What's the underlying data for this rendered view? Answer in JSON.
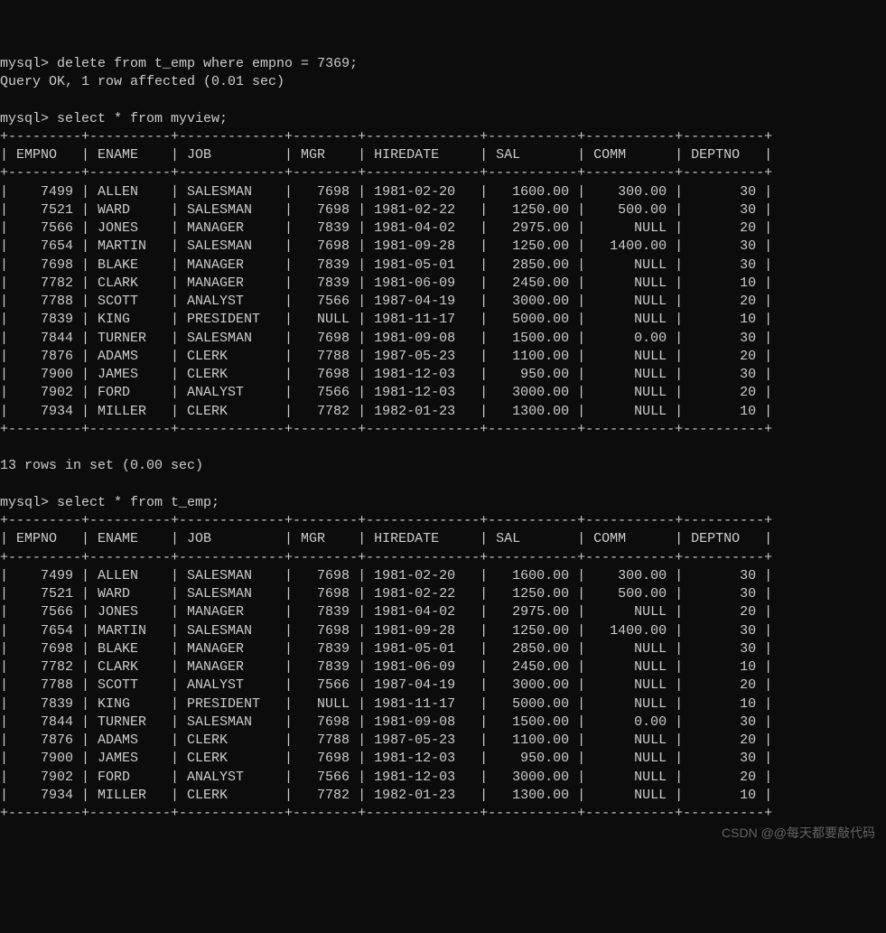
{
  "prompt": "mysql> ",
  "commands": {
    "delete": "delete from t_emp where empno = 7369;",
    "result1": "Query OK, 1 row affected (0.01 sec)",
    "select_view": "select * from myview;",
    "rows_in_set": "13 rows in set (0.00 sec)",
    "select_temp": "select * from t_emp;"
  },
  "columns": [
    "EMPNO",
    "ENAME",
    "JOB",
    "MGR",
    "HIREDATE",
    "SAL",
    "COMM",
    "DEPTNO"
  ],
  "widths": [
    7,
    8,
    11,
    6,
    12,
    9,
    9,
    8
  ],
  "col_align": [
    "right",
    "left",
    "left",
    "right",
    "left",
    "right",
    "right",
    "right"
  ],
  "rows": [
    {
      "EMPNO": "7499",
      "ENAME": "ALLEN",
      "JOB": "SALESMAN",
      "MGR": "7698",
      "HIREDATE": "1981-02-20",
      "SAL": "1600.00",
      "COMM": "300.00",
      "DEPTNO": "30"
    },
    {
      "EMPNO": "7521",
      "ENAME": "WARD",
      "JOB": "SALESMAN",
      "MGR": "7698",
      "HIREDATE": "1981-02-22",
      "SAL": "1250.00",
      "COMM": "500.00",
      "DEPTNO": "30"
    },
    {
      "EMPNO": "7566",
      "ENAME": "JONES",
      "JOB": "MANAGER",
      "MGR": "7839",
      "HIREDATE": "1981-04-02",
      "SAL": "2975.00",
      "COMM": "NULL",
      "DEPTNO": "20"
    },
    {
      "EMPNO": "7654",
      "ENAME": "MARTIN",
      "JOB": "SALESMAN",
      "MGR": "7698",
      "HIREDATE": "1981-09-28",
      "SAL": "1250.00",
      "COMM": "1400.00",
      "DEPTNO": "30"
    },
    {
      "EMPNO": "7698",
      "ENAME": "BLAKE",
      "JOB": "MANAGER",
      "MGR": "7839",
      "HIREDATE": "1981-05-01",
      "SAL": "2850.00",
      "COMM": "NULL",
      "DEPTNO": "30"
    },
    {
      "EMPNO": "7782",
      "ENAME": "CLARK",
      "JOB": "MANAGER",
      "MGR": "7839",
      "HIREDATE": "1981-06-09",
      "SAL": "2450.00",
      "COMM": "NULL",
      "DEPTNO": "10"
    },
    {
      "EMPNO": "7788",
      "ENAME": "SCOTT",
      "JOB": "ANALYST",
      "MGR": "7566",
      "HIREDATE": "1987-04-19",
      "SAL": "3000.00",
      "COMM": "NULL",
      "DEPTNO": "20"
    },
    {
      "EMPNO": "7839",
      "ENAME": "KING",
      "JOB": "PRESIDENT",
      "MGR": "NULL",
      "HIREDATE": "1981-11-17",
      "SAL": "5000.00",
      "COMM": "NULL",
      "DEPTNO": "10"
    },
    {
      "EMPNO": "7844",
      "ENAME": "TURNER",
      "JOB": "SALESMAN",
      "MGR": "7698",
      "HIREDATE": "1981-09-08",
      "SAL": "1500.00",
      "COMM": "0.00",
      "DEPTNO": "30"
    },
    {
      "EMPNO": "7876",
      "ENAME": "ADAMS",
      "JOB": "CLERK",
      "MGR": "7788",
      "HIREDATE": "1987-05-23",
      "SAL": "1100.00",
      "COMM": "NULL",
      "DEPTNO": "20"
    },
    {
      "EMPNO": "7900",
      "ENAME": "JAMES",
      "JOB": "CLERK",
      "MGR": "7698",
      "HIREDATE": "1981-12-03",
      "SAL": "950.00",
      "COMM": "NULL",
      "DEPTNO": "30"
    },
    {
      "EMPNO": "7902",
      "ENAME": "FORD",
      "JOB": "ANALYST",
      "MGR": "7566",
      "HIREDATE": "1981-12-03",
      "SAL": "3000.00",
      "COMM": "NULL",
      "DEPTNO": "20"
    },
    {
      "EMPNO": "7934",
      "ENAME": "MILLER",
      "JOB": "CLERK",
      "MGR": "7782",
      "HIREDATE": "1982-01-23",
      "SAL": "1300.00",
      "COMM": "NULL",
      "DEPTNO": "10"
    }
  ],
  "watermark": "CSDN @@每天都要敲代码"
}
